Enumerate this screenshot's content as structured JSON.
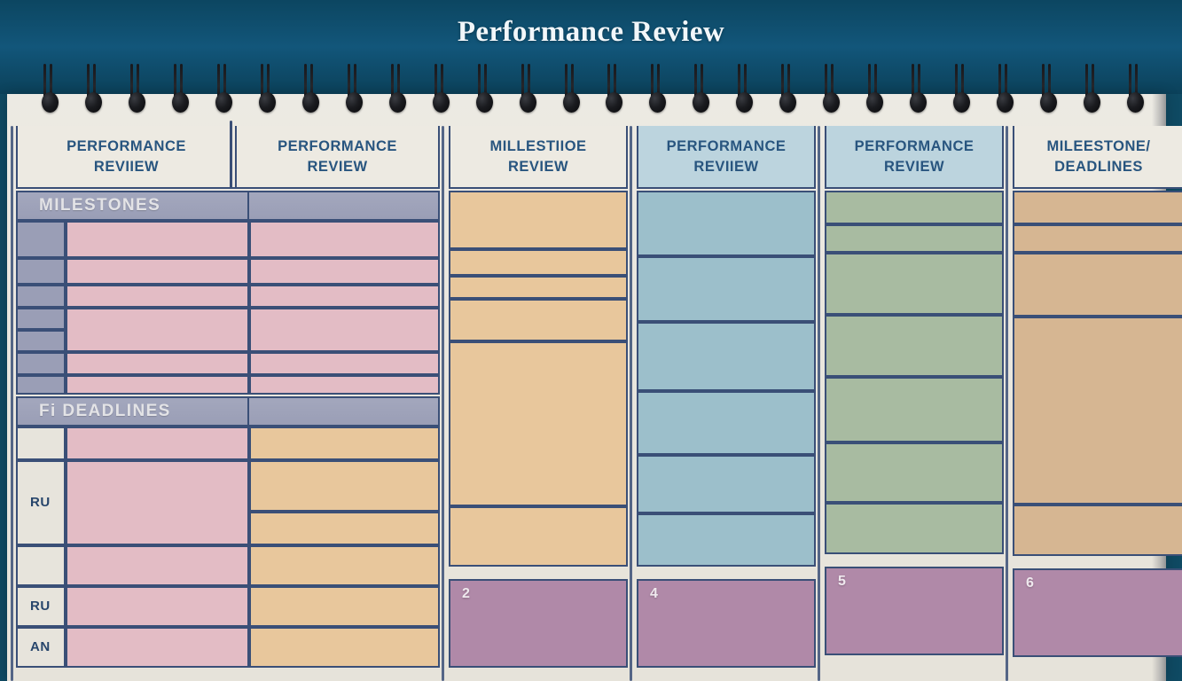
{
  "document": {
    "title": "Performance Review",
    "kind": "spiral-bound planner page"
  },
  "theme": {
    "header_bg": "#0c4661",
    "paper_bg": "#e9e6de",
    "rule": "#3a4f77",
    "header_text": "#28557f",
    "pink": "#e3bcc5",
    "tan": "#e8c79c",
    "tan_dark": "#d6b692",
    "blue": "#9cbfcb",
    "green": "#a8bba1",
    "plum": "#b089a8",
    "section_bar": "#9a9eb6"
  },
  "spiral": {
    "coil_count": 26
  },
  "columns": [
    {
      "id": "col1",
      "header_line1": "PERFORMANCE",
      "header_line2": "REVIIEW",
      "header_style": "cream"
    },
    {
      "id": "col2",
      "header_line1": "PERFORMANCE",
      "header_line2": "REVIEW",
      "header_style": "cream"
    },
    {
      "id": "col3",
      "header_line1": "MILLESTIIOE",
      "header_line2": "REVIEW",
      "header_style": "cream"
    },
    {
      "id": "col4",
      "header_line1": "PERFORMANCE",
      "header_line2": "REVIIEW",
      "header_style": "blue"
    },
    {
      "id": "col5",
      "header_line1": "PERFORMANCE",
      "header_line2": "REVIEW",
      "header_style": "blue"
    },
    {
      "id": "col6",
      "header_line1": "MILEESTONE/",
      "header_line2": "DEADLINES",
      "header_style": "cream"
    }
  ],
  "sections": {
    "milestones": {
      "label": "MILESTONES"
    },
    "deadlines": {
      "label": "Fi DEADLINES"
    }
  },
  "row_ticks": {
    "milestones": [
      "",
      "",
      "",
      "",
      "",
      "",
      ""
    ],
    "deadlines": [
      "",
      "RU",
      "",
      "RU",
      "AN"
    ]
  },
  "bottom_blocks": [
    {
      "column": "col3",
      "label": "2"
    },
    {
      "column": "col4",
      "label": "4"
    },
    {
      "column": "col5",
      "label": "5"
    },
    {
      "column": "col6",
      "label": "6"
    }
  ]
}
